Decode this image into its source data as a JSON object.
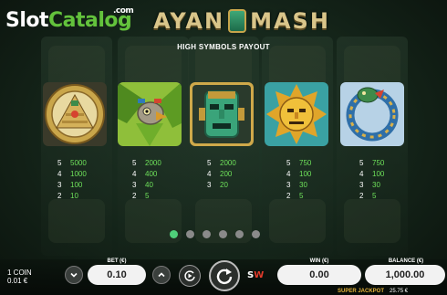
{
  "watermark": {
    "slot": "Slot",
    "catalog": "Catalog",
    "com": ".com"
  },
  "logo": {
    "left": "AYAN",
    "right": "MASH"
  },
  "heading": "HIGH SYMBOLS PAYOUT",
  "symbols": [
    {
      "icon": "pyramid-icon",
      "payouts": [
        {
          "count": "5",
          "amount": "5000"
        },
        {
          "count": "4",
          "amount": "1000"
        },
        {
          "count": "3",
          "amount": "100"
        },
        {
          "count": "2",
          "amount": "10"
        }
      ]
    },
    {
      "icon": "bird-mask-icon",
      "payouts": [
        {
          "count": "5",
          "amount": "2000"
        },
        {
          "count": "4",
          "amount": "400"
        },
        {
          "count": "3",
          "amount": "40"
        },
        {
          "count": "2",
          "amount": "5"
        }
      ]
    },
    {
      "icon": "jade-mask-icon",
      "payouts": [
        {
          "count": "5",
          "amount": "2000"
        },
        {
          "count": "4",
          "amount": "200"
        },
        {
          "count": "3",
          "amount": "20"
        }
      ]
    },
    {
      "icon": "sun-face-icon",
      "payouts": [
        {
          "count": "5",
          "amount": "750"
        },
        {
          "count": "4",
          "amount": "100"
        },
        {
          "count": "3",
          "amount": "30"
        },
        {
          "count": "2",
          "amount": "5"
        }
      ]
    },
    {
      "icon": "serpent-ring-icon",
      "payouts": [
        {
          "count": "5",
          "amount": "750"
        },
        {
          "count": "4",
          "amount": "100"
        },
        {
          "count": "3",
          "amount": "30"
        },
        {
          "count": "2",
          "amount": "5"
        }
      ]
    }
  ],
  "pagination": {
    "pages": 6,
    "active": 0
  },
  "controls": {
    "coin_label": "1 COIN",
    "coin_value": "0.01 €",
    "bet_label": "BET (€)",
    "bet_value": "0.10",
    "win_label": "WIN (€)",
    "win_value": "0.00",
    "balance_label": "BALANCE (€)",
    "balance_value": "1,000.00",
    "brand_s": "S",
    "brand_w": "W",
    "jackpot_label": "SUPER JACKPOT",
    "jackpot_value": "25.75 €"
  },
  "colors": {
    "payout": "#6ee05a",
    "active_dot": "#4fd07a",
    "accent_gold": "#d9c58a"
  }
}
